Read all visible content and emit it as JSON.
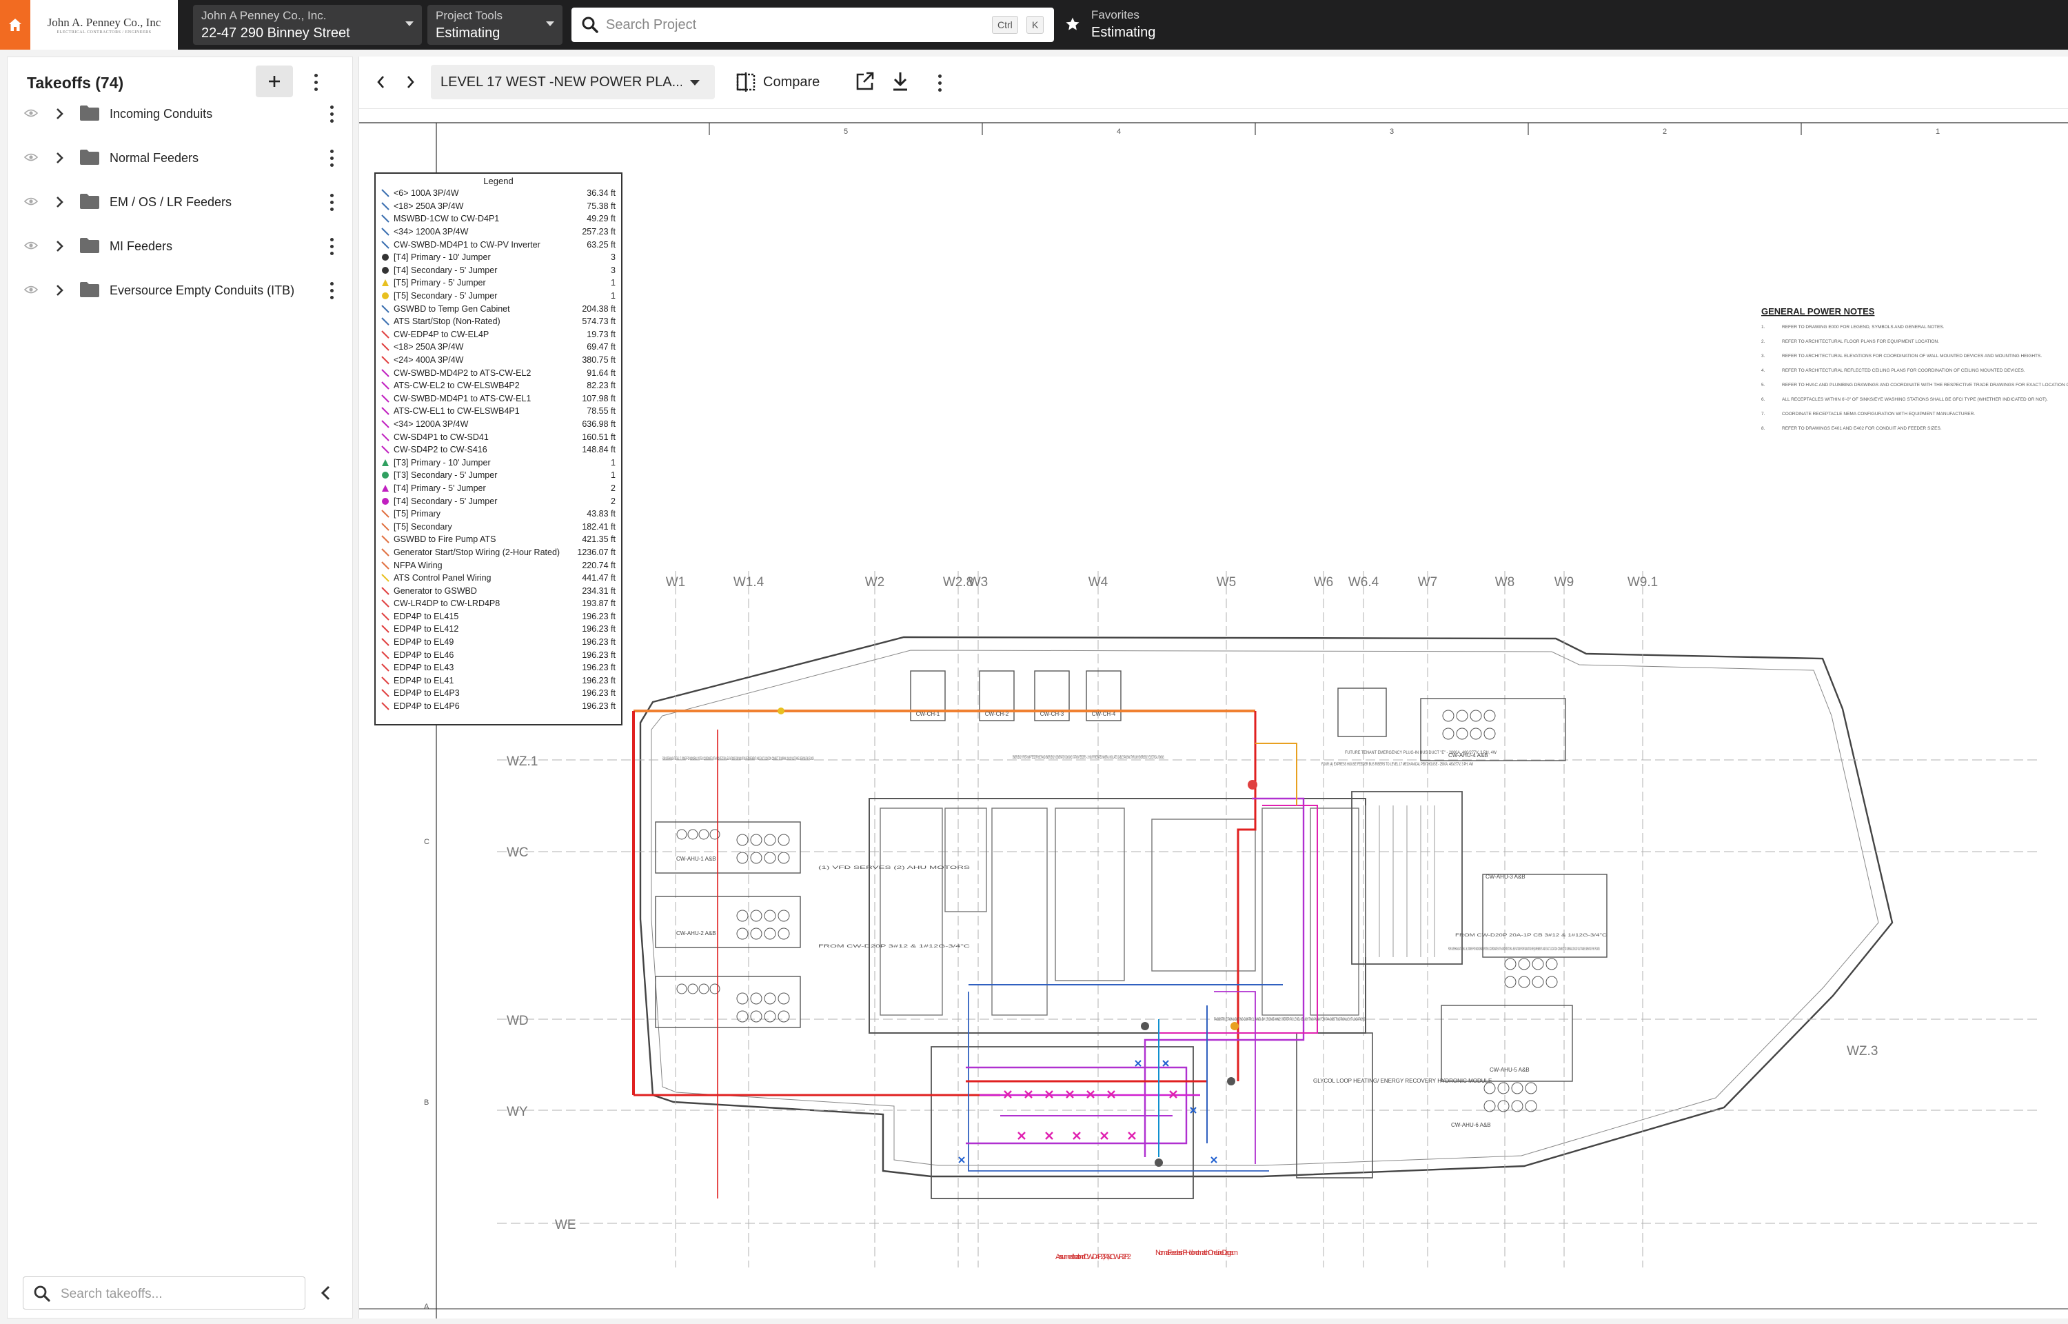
{
  "topbar": {
    "logo_line1": "John A. Penney Co., Inc",
    "logo_line2": "ELECTRICAL CONTRACTORS / ENGINEERS",
    "company_label": "John A Penney Co., Inc.",
    "project_name": "22-47 290 Binney Street",
    "tools_label": "Project Tools",
    "tools_value": "Estimating",
    "search_placeholder": "Search Project",
    "kbd_ctrl": "Ctrl",
    "kbd_k": "K",
    "favorites_label": "Favorites",
    "favorites_value": "Estimating"
  },
  "takeoffs": {
    "title": "Takeoffs (74)",
    "folders": [
      {
        "label": "Incoming Conduits"
      },
      {
        "label": "Normal Feeders"
      },
      {
        "label": "EM / OS / LR Feeders"
      },
      {
        "label": "MI Feeders"
      },
      {
        "label": "Eversource Empty Conduits (ITB)"
      }
    ],
    "search_placeholder": "Search takeoffs..."
  },
  "toolbar": {
    "sheet_name": "LEVEL 17 WEST -NEW POWER PLA...",
    "compare_label": "Compare"
  },
  "legend": {
    "title": "Legend",
    "items": [
      {
        "name": "<6> 100A 3P/4W",
        "value": "36.34 ft",
        "color": "#3a6fb0",
        "shape": "line"
      },
      {
        "name": "<18> 250A 3P/4W",
        "value": "75.38 ft",
        "color": "#3a6fb0",
        "shape": "line"
      },
      {
        "name": "MSWBD-1CW to CW-D4P1",
        "value": "49.29 ft",
        "color": "#3a6fb0",
        "shape": "line"
      },
      {
        "name": "<34> 1200A 3P/4W",
        "value": "257.23 ft",
        "color": "#3a6fb0",
        "shape": "line"
      },
      {
        "name": "CW-SWBD-MD4P1 to CW-PV Inverter",
        "value": "63.25 ft",
        "color": "#3a6fb0",
        "shape": "line"
      },
      {
        "name": "[T4] Primary - 10' Jumper",
        "value": "3",
        "color": "#333333",
        "shape": "dot"
      },
      {
        "name": "[T4] Secondary - 5' Jumper",
        "value": "3",
        "color": "#333333",
        "shape": "dot"
      },
      {
        "name": "[T5] Primary - 5' Jumper",
        "value": "1",
        "color": "#e8c020",
        "shape": "tri"
      },
      {
        "name": "[T5] Secondary - 5' Jumper",
        "value": "1",
        "color": "#e8c020",
        "shape": "dot"
      },
      {
        "name": "GSWBD to Temp Gen Cabinet",
        "value": "204.38 ft",
        "color": "#3a6fb0",
        "shape": "line"
      },
      {
        "name": "ATS Start/Stop (Non-Rated)",
        "value": "574.73 ft",
        "color": "#3a6fb0",
        "shape": "line"
      },
      {
        "name": "CW-EDP4P to CW-EL4P",
        "value": "19.73 ft",
        "color": "#e04040",
        "shape": "line"
      },
      {
        "name": "<18> 250A 3P/4W",
        "value": "69.47 ft",
        "color": "#e04040",
        "shape": "line"
      },
      {
        "name": "<24> 400A 3P/4W",
        "value": "380.75 ft",
        "color": "#e04040",
        "shape": "line"
      },
      {
        "name": "CW-SWBD-MD4P2 to ATS-CW-EL2",
        "value": "91.64 ft",
        "color": "#c020c0",
        "shape": "line"
      },
      {
        "name": "ATS-CW-EL2 to CW-ELSWB4P2",
        "value": "82.23 ft",
        "color": "#c020c0",
        "shape": "line"
      },
      {
        "name": "CW-SWBD-MD4P1 to ATS-CW-EL1",
        "value": "107.98 ft",
        "color": "#c020c0",
        "shape": "line"
      },
      {
        "name": "ATS-CW-EL1 to CW-ELSWB4P1",
        "value": "78.55 ft",
        "color": "#c020c0",
        "shape": "line"
      },
      {
        "name": "<34> 1200A 3P/4W",
        "value": "636.98 ft",
        "color": "#c020c0",
        "shape": "line"
      },
      {
        "name": "CW-SD4P1 to CW-SD41",
        "value": "160.51 ft",
        "color": "#c020c0",
        "shape": "line"
      },
      {
        "name": "CW-SD4P2 to CW-S416",
        "value": "148.84 ft",
        "color": "#c020c0",
        "shape": "line"
      },
      {
        "name": "[T3] Primary - 10' Jumper",
        "value": "1",
        "color": "#30a060",
        "shape": "tri"
      },
      {
        "name": "[T3] Secondary - 5' Jumper",
        "value": "1",
        "color": "#30a060",
        "shape": "dot"
      },
      {
        "name": "[T4] Primary - 5' Jumper",
        "value": "2",
        "color": "#c020c0",
        "shape": "tri"
      },
      {
        "name": "[T4] Secondary - 5' Jumper",
        "value": "2",
        "color": "#c020c0",
        "shape": "dot"
      },
      {
        "name": "[T5] Primary",
        "value": "43.83 ft",
        "color": "#e07040",
        "shape": "line"
      },
      {
        "name": "[T5] Secondary",
        "value": "182.41 ft",
        "color": "#e07040",
        "shape": "line"
      },
      {
        "name": "GSWBD to Fire Pump ATS",
        "value": "421.35 ft",
        "color": "#e07040",
        "shape": "line"
      },
      {
        "name": "Generator Start/Stop Wiring (2-Hour Rated)",
        "value": "1236.07 ft",
        "color": "#e07040",
        "shape": "line"
      },
      {
        "name": "NFPA Wiring",
        "value": "220.74 ft",
        "color": "#e07040",
        "shape": "line"
      },
      {
        "name": "ATS Control Panel Wiring",
        "value": "441.47 ft",
        "color": "#e8c020",
        "shape": "line"
      },
      {
        "name": "Generator to GSWBD",
        "value": "234.31 ft",
        "color": "#e04040",
        "shape": "line"
      },
      {
        "name": "CW-LR4DP to CW-LRD4P8",
        "value": "193.87 ft",
        "color": "#e04040",
        "shape": "line"
      },
      {
        "name": "EDP4P to EL415",
        "value": "196.23 ft",
        "color": "#e04040",
        "shape": "line"
      },
      {
        "name": "EDP4P to EL412",
        "value": "196.23 ft",
        "color": "#e04040",
        "shape": "line"
      },
      {
        "name": "EDP4P to EL49",
        "value": "196.23 ft",
        "color": "#e04040",
        "shape": "line"
      },
      {
        "name": "EDP4P to EL46",
        "value": "196.23 ft",
        "color": "#e04040",
        "shape": "line"
      },
      {
        "name": "EDP4P to EL43",
        "value": "196.23 ft",
        "color": "#e04040",
        "shape": "line"
      },
      {
        "name": "EDP4P to EL41",
        "value": "196.23 ft",
        "color": "#e04040",
        "shape": "line"
      },
      {
        "name": "EDP4P to EL4P3",
        "value": "196.23 ft",
        "color": "#e04040",
        "shape": "line"
      },
      {
        "name": "EDP4P to EL4P6",
        "value": "196.23 ft",
        "color": "#e04040",
        "shape": "line"
      }
    ]
  },
  "drawing": {
    "column_labels": [
      "W1",
      "W1.4",
      "W2",
      "W2.8",
      "W3",
      "W4",
      "W5",
      "W6",
      "W6.4",
      "W7",
      "W8",
      "W9",
      "W9.1"
    ],
    "row_labels": [
      "WZ.1",
      "WC",
      "WD",
      "WY",
      "WE",
      "WZ.3"
    ],
    "ruler_numbers": [
      "5",
      "4",
      "3",
      "2",
      "1"
    ],
    "side_letters": [
      "C",
      "B",
      "A"
    ],
    "notes_title": "GENERAL POWER NOTES",
    "notes": [
      "REFER TO DRAWING E000 FOR LEGEND, SYMBOLS AND GENERAL NOTES.",
      "REFER TO ARCHITECTURAL FLOOR PLANS FOR EQUIPMENT LOCATION.",
      "REFER TO ARCHITECTURAL ELEVATIONS FOR COORDINATION OF WALL MOUNTED DEVICES AND MOUNTING HEIGHTS.",
      "REFER TO ARCHITECTURAL REFLECTED CEILING PLANS FOR COORDINATION OF CEILING MOUNTED DEVICES.",
      "REFER TO HVAC AND PLUMBING DRAWINGS AND COORDINATE WITH THE RESPECTIVE TRADE DRAWINGS FOR EXACT LOCATION OF ALL OF THE EQUIPMENT REQUIRING ELECTRIC POWER.",
      "ALL RECEPTACLES WITHIN 6'-0\" OF SINKS/EYE WASHING STATIONS SHALL BE GFCI TYPE (WHETHER INDICATED OR NOT).",
      "COORDINATE RECEPTACLE NEMA CONFIGURATION WITH EQUIPMENT MANUFACTURER.",
      "REFER TO DRAWINGS E401 AND E402 FOR CONDUIT AND FEEDER SIZES."
    ],
    "annotation_1": "Assumed location of CW-D4P2, T4, & CW-R2P2",
    "annotation_2": "Normal Feeders in PH do not match One Line Diagram",
    "equip_labels": [
      "CW-CH-1",
      "CW-CH-2",
      "CW-CH-3",
      "CW-CH-4",
      "CW-AHU-1 A&B",
      "CW-AHU-2 A&B",
      "CW-AHU-3 A&B",
      "CW-AHU-4 A&B",
      "CW-AHU-5 A&B",
      "CW-AHU-6 A&B",
      "GLYCOL LOOP HEATING/ ENERGY RECOVERY HYDRONIC MODULE"
    ],
    "note_texts": [
      "FOR OVERHANG AT LEVEL 17, POWER FOR MONORAIL SYSTEM. COORDINATE WITH ARCHITECTURAL ELEVATIONS FOR MOUNTING REQUIREMENTS AND EXACT LOCATION. CONNECT TO NORMAL 208/120 VOLT PANEL SERVING THIS FLOOR.",
      "EMERGENCY FIRE PUMP FEEDER RISER AND EMERGENCY GENERATOR DOCKING STATION FEEDERS - 2 HOUR FIRE RATED MINERAL INSULATED CABLES PASSING THROUGH EMERGENCY ELECTRICAL ROOMS.",
      "FUTURE TENANT EMERGENCY PLUG-IN BUS DUCT \"E\" - 2000A, 480/277V, 3 PH, 4W",
      "FOUR (4) EXPRESS HOUSE FEEDER BUS RISERS TO LEVEL 17 MECHANICAL PENTHOUSE - 2500A, 480/277V, 3 PH, 4W",
      "(1) VFD SERVES (2) AHU MOTORS",
      "FROM CW-D20P 3#12 & 1#12G-3/4\"C",
      "FROM CW-D20P 20A-1P CB 3#12 & 1#12G-3/4\"C",
      "FOR OVERHANG AT LEVEL 16, POWER FOR MONORAIL SYSTEM. COORDINATE WITH ARCHITECTURAL ELEVATIONS FOR MOUNTING REQUIREMENTS AND EXACT LOCATION. CONNECT TO NORMAL 208/120 VOLT PANEL SERVING THIS FLOOR.",
      "FA/OBSTRUCTION LIGHTING CONTROL PANEL BY CROSSE-HINDS REFER TO LEVEL 25 LIGHTING PLAN FOR FAA OBSTRUCTION LIGHT LOCATIONS."
    ]
  }
}
